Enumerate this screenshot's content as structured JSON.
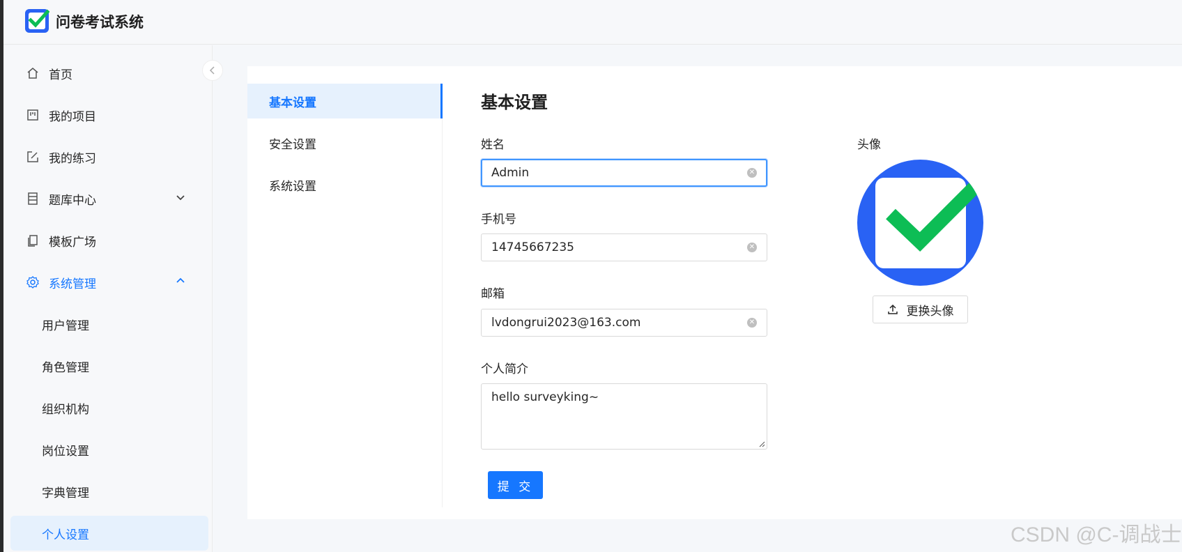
{
  "app": {
    "title": "问卷考试系统"
  },
  "sidebar": {
    "items": [
      {
        "label": "首页",
        "icon": "home-icon"
      },
      {
        "label": "我的项目",
        "icon": "project-icon"
      },
      {
        "label": "我的练习",
        "icon": "edit-icon"
      },
      {
        "label": "题库中心",
        "icon": "database-icon"
      },
      {
        "label": "模板广场",
        "icon": "copy-icon"
      },
      {
        "label": "系统管理",
        "icon": "gear-icon"
      }
    ],
    "sub_items": [
      {
        "label": "用户管理"
      },
      {
        "label": "角色管理"
      },
      {
        "label": "组织机构"
      },
      {
        "label": "岗位设置"
      },
      {
        "label": "字典管理"
      },
      {
        "label": "个人设置"
      }
    ]
  },
  "settings_nav": [
    {
      "label": "基本设置"
    },
    {
      "label": "安全设置"
    },
    {
      "label": "系统设置"
    }
  ],
  "form": {
    "section_title": "基本设置",
    "name": {
      "label": "姓名",
      "value": "Admin"
    },
    "phone": {
      "label": "手机号",
      "value": "14745667235"
    },
    "email": {
      "label": "邮箱",
      "value": "lvdongrui2023@163.com"
    },
    "bio": {
      "label": "个人简介",
      "value": "hello surveyking~"
    },
    "submit_label": "提 交"
  },
  "avatar": {
    "label": "头像",
    "change_label": "更换头像"
  },
  "watermark": "CSDN @C-调战士",
  "colors": {
    "accent": "#1677ff",
    "logo_blue": "#2962f4",
    "check_green": "#0dbd55"
  }
}
